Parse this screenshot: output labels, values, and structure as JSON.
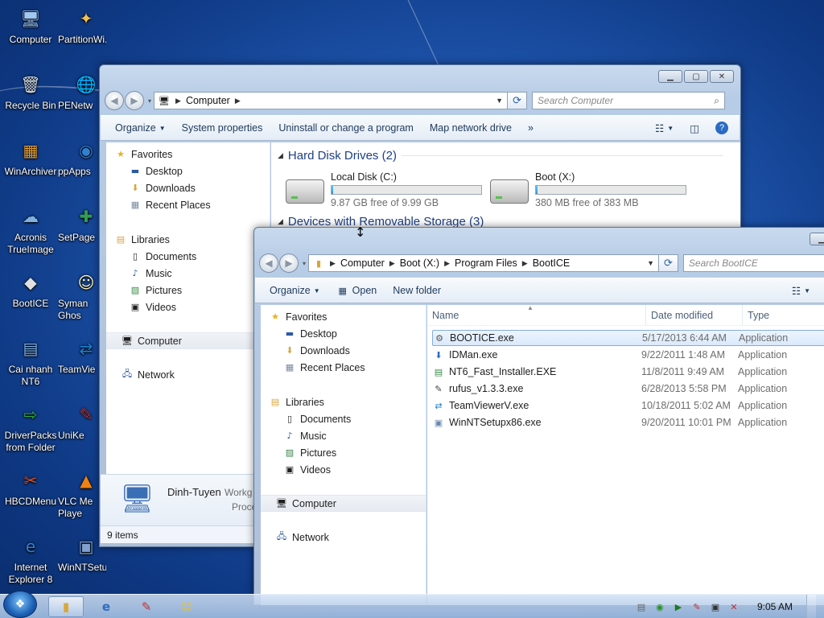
{
  "desktop": {
    "icons": [
      {
        "label": "Computer",
        "glyph": "🖥"
      },
      {
        "label": "PartitionWi...",
        "glyph": "✦"
      },
      {
        "label": "Recycle Bin",
        "glyph": "🗑"
      },
      {
        "label": "PENetw",
        "glyph": "🌐"
      },
      {
        "label": "WinArchiver",
        "glyph": "▦"
      },
      {
        "label": "ppApps",
        "glyph": "◉"
      },
      {
        "label": "Acronis TrueImage",
        "glyph": "☁"
      },
      {
        "label": "SetPage",
        "glyph": "✚"
      },
      {
        "label": "BootICE",
        "glyph": "◆"
      },
      {
        "label": "Syman Ghos",
        "glyph": "☺"
      },
      {
        "label": "Cai nhanh NT6",
        "glyph": "▤"
      },
      {
        "label": "TeamVie",
        "glyph": "⇄"
      },
      {
        "label": "DriverPacks from Folder",
        "glyph": "⇨"
      },
      {
        "label": "UniKe",
        "glyph": "✎"
      },
      {
        "label": "HBCDMenu",
        "glyph": "✂"
      },
      {
        "label": "VLC Me Playe",
        "glyph": "▲"
      },
      {
        "label": "Internet Explorer 8",
        "glyph": "e"
      },
      {
        "label": "WinNTSetup",
        "glyph": "▣"
      }
    ]
  },
  "win1": {
    "address": [
      "Computer"
    ],
    "search_placeholder": "Search Computer",
    "toolbar": [
      "Organize",
      "System properties",
      "Uninstall or change a program",
      "Map network drive",
      "»"
    ],
    "nav": {
      "favorites": "Favorites",
      "fav_items": [
        "Desktop",
        "Downloads",
        "Recent Places"
      ],
      "libraries": "Libraries",
      "lib_items": [
        "Documents",
        "Music",
        "Pictures",
        "Videos"
      ],
      "computer": "Computer",
      "network": "Network"
    },
    "group_hdd": "Hard Disk Drives (2)",
    "drives": [
      {
        "name": "Local Disk (C:)",
        "free": "9.87 GB free of 9.99 GB",
        "used_fraction": 0.012
      },
      {
        "name": "Boot (X:)",
        "free": "380 MB free of 383 MB",
        "used_fraction": 0.008
      }
    ],
    "group_removable": "Devices with Removable Storage (3)",
    "details": {
      "name": "Dinh-Tuyen",
      "workgroup": "Workg",
      "processor": "Proce"
    },
    "status": "9 items"
  },
  "win2": {
    "address": [
      "Computer",
      "Boot (X:)",
      "Program Files",
      "BootICE"
    ],
    "search_placeholder": "Search BootICE",
    "toolbar": {
      "organize": "Organize",
      "open": "Open",
      "new_folder": "New folder"
    },
    "nav": {
      "favorites": "Favorites",
      "fav_items": [
        "Desktop",
        "Downloads",
        "Recent Places"
      ],
      "libraries": "Libraries",
      "lib_items": [
        "Documents",
        "Music",
        "Pictures",
        "Videos"
      ],
      "computer": "Computer",
      "network": "Network"
    },
    "columns": {
      "name": "Name",
      "date": "Date modified",
      "type": "Type"
    },
    "files": [
      {
        "name": "BOOTICE.exe",
        "date": "5/17/2013 6:44 AM",
        "type": "Application",
        "icon": "⚙"
      },
      {
        "name": "IDMan.exe",
        "date": "9/22/2011 1:48 AM",
        "type": "Application",
        "icon": "⬇"
      },
      {
        "name": "NT6_Fast_Installer.EXE",
        "date": "11/8/2011 9:49 AM",
        "type": "Application",
        "icon": "▤"
      },
      {
        "name": "rufus_v1.3.3.exe",
        "date": "6/28/2013 5:58 PM",
        "type": "Application",
        "icon": "✎"
      },
      {
        "name": "TeamViewerV.exe",
        "date": "10/18/2011 5:02 AM",
        "type": "Application",
        "icon": "⇄"
      },
      {
        "name": "WinNTSetupx86.exe",
        "date": "9/20/2011 10:01 PM",
        "type": "Application",
        "icon": "▣"
      }
    ]
  },
  "taskbar": {
    "clock": "9:05 AM"
  }
}
